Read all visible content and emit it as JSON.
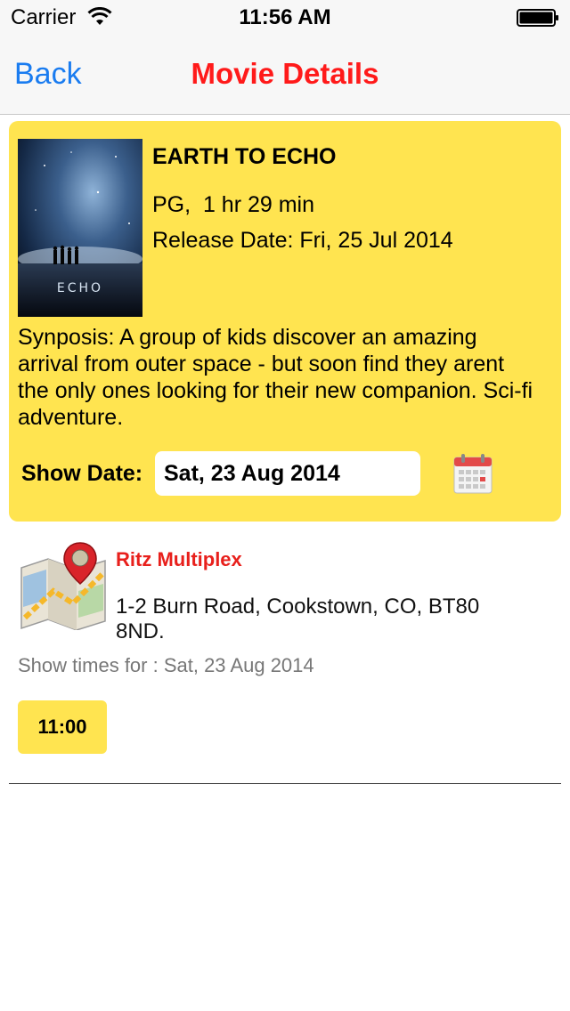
{
  "status_bar": {
    "carrier": "Carrier",
    "time": "11:56 AM"
  },
  "nav": {
    "back_label": "Back",
    "title": "Movie Details"
  },
  "movie": {
    "title": "EARTH TO ECHO",
    "rating_runtime": "PG,  1 hr 29 min",
    "release": "Release Date: Fri, 25 Jul 2014",
    "synopsis": "Synposis: A group of kids discover an amazing arrival from outer space - but soon find they arent the only ones looking for their new companion.  Sci-fi adventure.",
    "poster_text": "ECHO"
  },
  "show_date": {
    "label": "Show Date:",
    "value": "Sat, 23 Aug 2014"
  },
  "cinema": {
    "name": "Ritz Multiplex",
    "address": "1-2 Burn Road, Cookstown, CO, BT80 8ND.",
    "showtimes_label": "Show times for : Sat, 23 Aug 2014",
    "times": [
      "11:00"
    ]
  },
  "colors": {
    "accent_yellow": "#ffe450",
    "title_red": "#ff1a1a",
    "back_blue": "#1a7cf0"
  }
}
